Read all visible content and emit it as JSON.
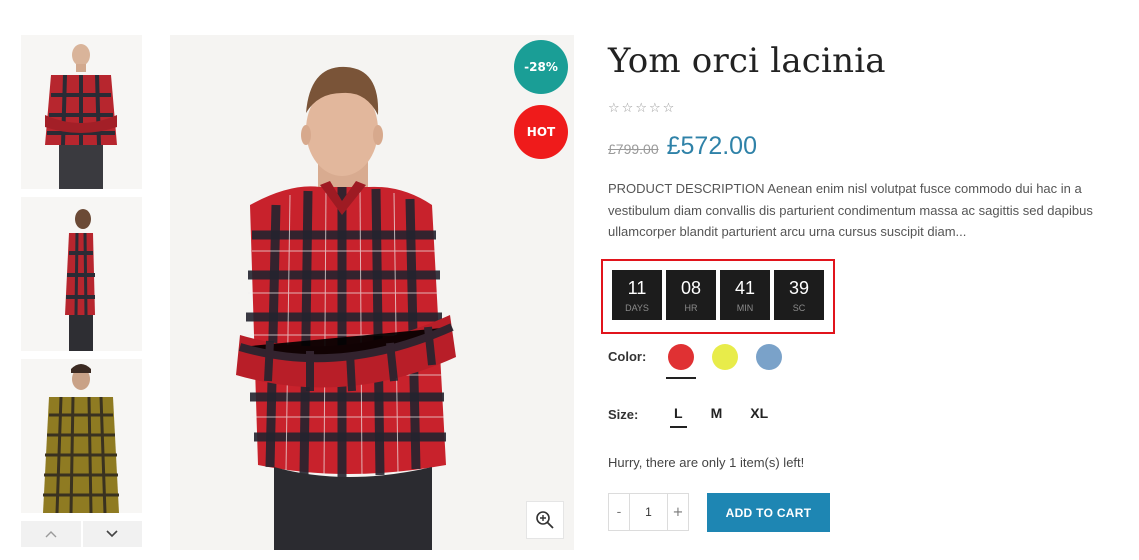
{
  "gallery": {
    "thumbnails": [
      {
        "alt": "red-plaid-shirt-front"
      },
      {
        "alt": "red-plaid-shirt-side"
      },
      {
        "alt": "yellow-plaid-shirt-front"
      }
    ],
    "nav_up_icon": "chevron-up-icon",
    "nav_down_icon": "chevron-down-icon"
  },
  "main_image": {
    "badge_sale": "-28%",
    "badge_hot": "HOT",
    "zoom_icon": "zoom-in-icon",
    "colors": {
      "sale": "#1a9e96",
      "hot": "#ef1b1b"
    }
  },
  "product": {
    "title": "Yom orci lacinia",
    "rating": 0,
    "rating_max": 5,
    "old_price": "£799.00",
    "price": "£572.00",
    "description": "PRODUCT DESCRIPTION Aenean enim nisl volutpat fusce commodo dui hac in a vestibulum diam convallis dis parturient condimentum massa ac sagittis sed dapibus ullamcorper blandit parturient arcu urna cursus suscipit diam..."
  },
  "countdown": {
    "days": "11",
    "days_label": "DAYS",
    "hours": "08",
    "hours_label": "HR",
    "minutes": "41",
    "minutes_label": "MIN",
    "seconds": "39",
    "seconds_label": "SC"
  },
  "options": {
    "color_label": "Color:",
    "colors": [
      "#e03133",
      "#e8ec4a",
      "#7aa2c9"
    ],
    "selected_color_index": 0,
    "size_label": "Size:",
    "sizes": [
      "L",
      "M",
      "XL"
    ],
    "selected_size": "L"
  },
  "stock_text": "Hurry, there are only 1 item(s) left!",
  "cart": {
    "minus": "-",
    "quantity": "1",
    "plus": "+",
    "add_label": "ADD TO CART",
    "accent": "#1e86b3"
  }
}
